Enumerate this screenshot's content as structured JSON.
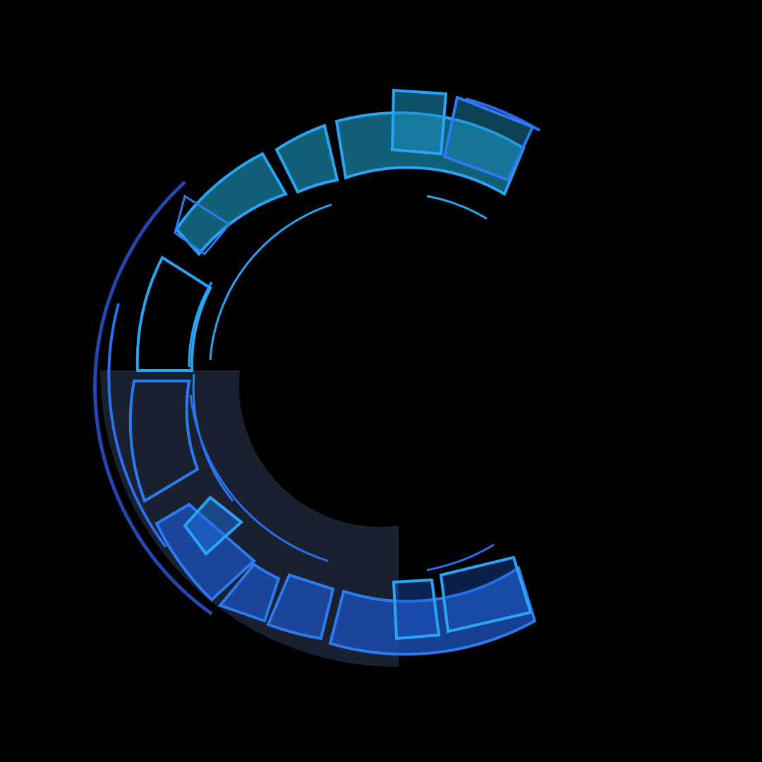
{
  "graphic": {
    "name": "hud-ring-logo",
    "shape": "letter-c-ring",
    "colors": {
      "background": "#000000",
      "cyan_outline": "#2aa4f4",
      "cyan_fill": "#17809f",
      "blue_outline": "#2c7bf0",
      "blue_fill": "#1b4fb5",
      "navy_fill": "#1a2333",
      "dark_arc": "#2a4fc2"
    }
  }
}
